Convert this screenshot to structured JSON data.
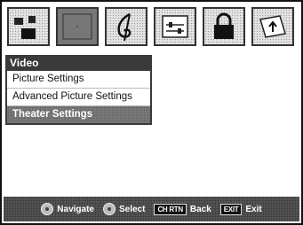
{
  "icons": [
    {
      "name": "picture-icon",
      "active": false
    },
    {
      "name": "video-icon",
      "active": true
    },
    {
      "name": "audio-icon",
      "active": false
    },
    {
      "name": "setup-icon",
      "active": false
    },
    {
      "name": "lock-icon",
      "active": false
    },
    {
      "name": "applications-icon",
      "active": false
    }
  ],
  "menu": {
    "title": "Video",
    "items": [
      "Picture Settings",
      "Advanced Picture Settings",
      "Theater Settings"
    ],
    "selected_index": 2
  },
  "footer": {
    "navigate": "Navigate",
    "select": "Select",
    "back_key": "CH RTN",
    "back": "Back",
    "exit_key": "EXIT",
    "exit": "Exit"
  },
  "colors": {
    "title_bar": "#3a3a3a",
    "selected": "#777777",
    "footer": "#555555"
  }
}
